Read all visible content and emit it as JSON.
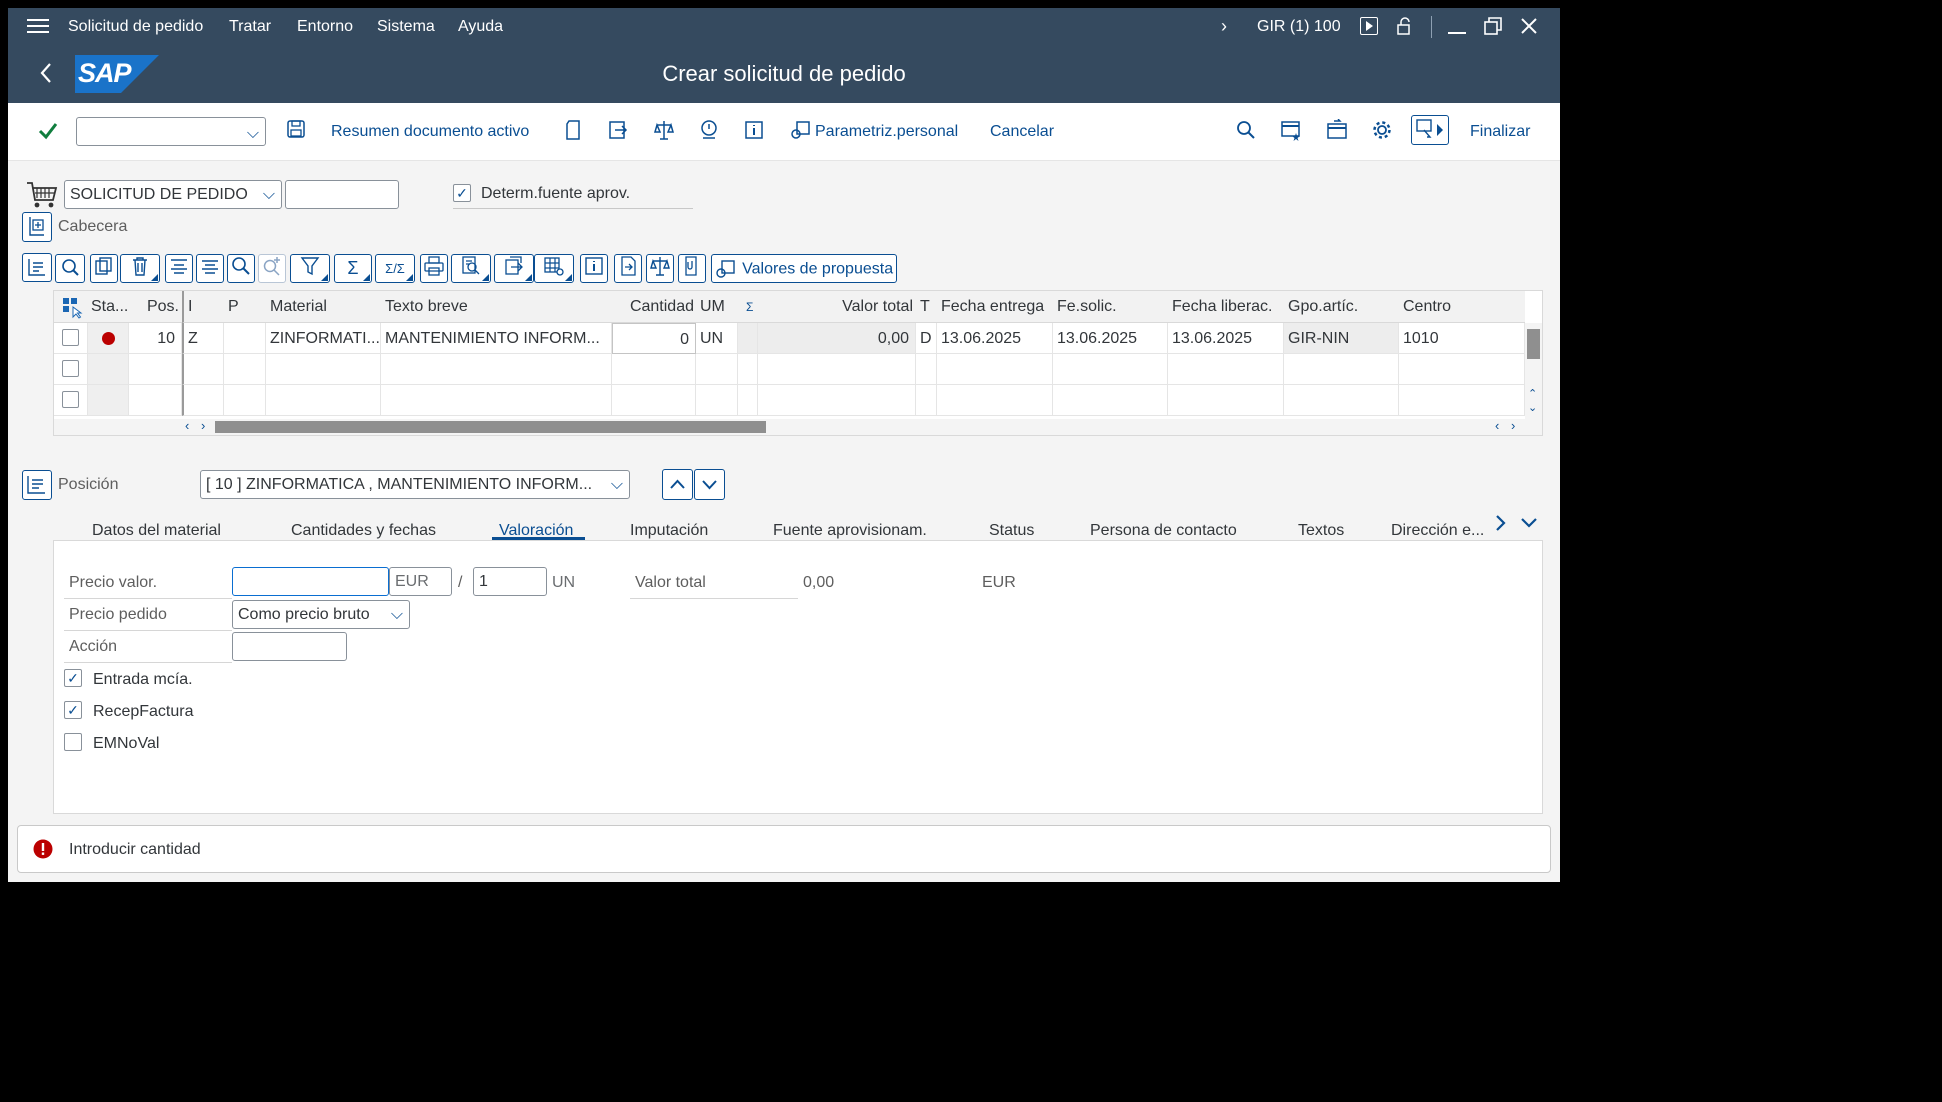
{
  "menubar": {
    "items": [
      "Solicitud de pedido",
      "Tratar",
      "Entorno",
      "Sistema",
      "Ayuda"
    ],
    "system_info": "GIR (1) 100"
  },
  "titlebar": {
    "title": "Crear solicitud de pedido",
    "logo_text": "SAP"
  },
  "toolbar": {
    "command_field": "",
    "resumen_label": "Resumen documento activo",
    "parametriz_label": "Parametriz.personal",
    "cancelar_label": "Cancelar",
    "finalizar_label": "Finalizar"
  },
  "doc_header": {
    "doc_type": "SOLICITUD DE PEDIDO",
    "doc_number": "",
    "determ_label": "Determ.fuente aprov.",
    "determ_checked": true,
    "cabecera_label": "Cabecera"
  },
  "grid_toolbar": {
    "valores_label": "Valores de propuesta"
  },
  "grid": {
    "columns": [
      "Sta...",
      "Pos.",
      "I",
      "P",
      "Material",
      "Texto breve",
      "Cantidad",
      "UM",
      "Σ",
      "Valor total",
      "T",
      "Fecha entrega",
      "Fe.solic.",
      "Fecha liberac.",
      "Gpo.artíc.",
      "Centro"
    ],
    "rows": [
      {
        "status_color": "#bb0000",
        "pos": "10",
        "i": "Z",
        "p": "",
        "material": "ZINFORMATI...",
        "texto": "MANTENIMIENTO INFORM...",
        "cantidad": "0",
        "um": "UN",
        "valor": "0,00",
        "t": "D",
        "fecha_entrega": "13.06.2025",
        "fe_solic": "13.06.2025",
        "fecha_lib": "13.06.2025",
        "gpo": "GIR-NIN",
        "centro": "1010"
      },
      {
        "status_color": "",
        "pos": "",
        "i": "",
        "p": "",
        "material": "",
        "texto": "",
        "cantidad": "",
        "um": "",
        "valor": "",
        "t": "",
        "fecha_entrega": "",
        "fe_solic": "",
        "fecha_lib": "",
        "gpo": "",
        "centro": ""
      },
      {
        "status_color": "",
        "pos": "",
        "i": "",
        "p": "",
        "material": "",
        "texto": "",
        "cantidad": "",
        "um": "",
        "valor": "",
        "t": "",
        "fecha_entrega": "",
        "fe_solic": "",
        "fecha_lib": "",
        "gpo": "",
        "centro": ""
      }
    ]
  },
  "position": {
    "label": "Posición",
    "selected": "[ 10 ] ZINFORMATICA , MANTENIMIENTO INFORM..."
  },
  "tabs": [
    "Datos del material",
    "Cantidades y fechas",
    "Valoración",
    "Imputación",
    "Fuente aprovisionam.",
    "Status",
    "Persona de contacto",
    "Textos",
    "Dirección e..."
  ],
  "active_tab": "Valoración",
  "valoracion": {
    "precio_valor_label": "Precio valor.",
    "precio_valor_value": "",
    "currency": "EUR",
    "per_symbol": "/",
    "per_value": "1",
    "per_unit": "UN",
    "valor_total_label": "Valor total",
    "valor_total_value": "0,00",
    "valor_total_currency": "EUR",
    "precio_pedido_label": "Precio pedido",
    "precio_pedido_value": "Como precio bruto",
    "accion_label": "Acción",
    "accion_value": "",
    "entrada_label": "Entrada mcía.",
    "entrada_checked": true,
    "recep_label": "RecepFactura",
    "recep_checked": true,
    "emnoval_label": "EMNoVal",
    "emnoval_checked": false
  },
  "status_bar": {
    "message": "Introducir cantidad",
    "type": "error"
  }
}
